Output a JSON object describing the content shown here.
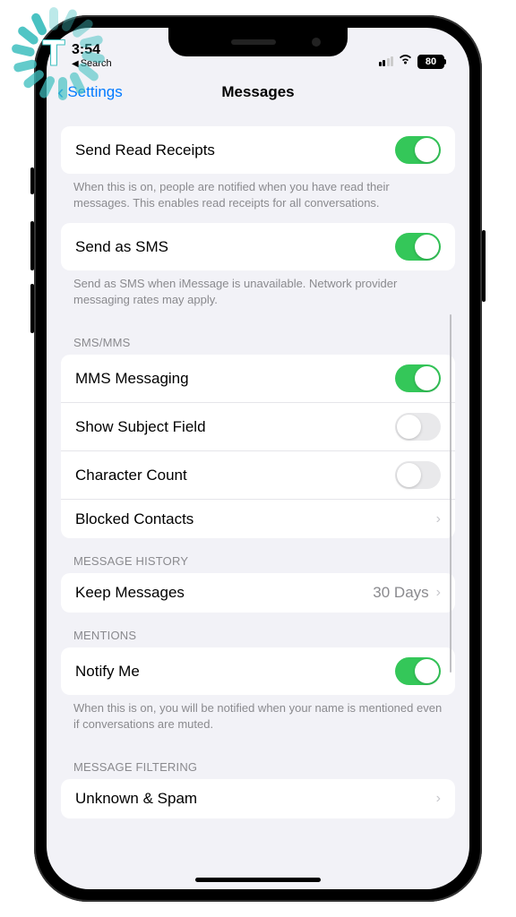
{
  "status": {
    "time": "3:54",
    "search_label": "Search",
    "battery": "80"
  },
  "nav": {
    "back_label": "Settings",
    "title": "Messages"
  },
  "sections": {
    "read_receipts": {
      "label": "Send Read Receipts",
      "footer": "When this is on, people are notified when you have read their messages. This enables read receipts for all conversations."
    },
    "send_sms": {
      "label": "Send as SMS",
      "footer": "Send as SMS when iMessage is unavailable. Network provider messaging rates may apply."
    },
    "sms_mms": {
      "header": "SMS/MMS",
      "mms_label": "MMS Messaging",
      "subject_label": "Show Subject Field",
      "char_count_label": "Character Count",
      "blocked_label": "Blocked Contacts"
    },
    "history": {
      "header": "MESSAGE HISTORY",
      "keep_label": "Keep Messages",
      "keep_value": "30 Days"
    },
    "mentions": {
      "header": "MENTIONS",
      "notify_label": "Notify Me",
      "footer": "When this is on, you will be notified when your name is mentioned even if conversations are muted."
    },
    "filtering": {
      "header": "MESSAGE FILTERING",
      "unknown_label": "Unknown & Spam"
    }
  },
  "toggles": {
    "read_receipts": true,
    "send_sms": true,
    "mms": true,
    "subject": false,
    "char_count": false,
    "notify": true
  }
}
